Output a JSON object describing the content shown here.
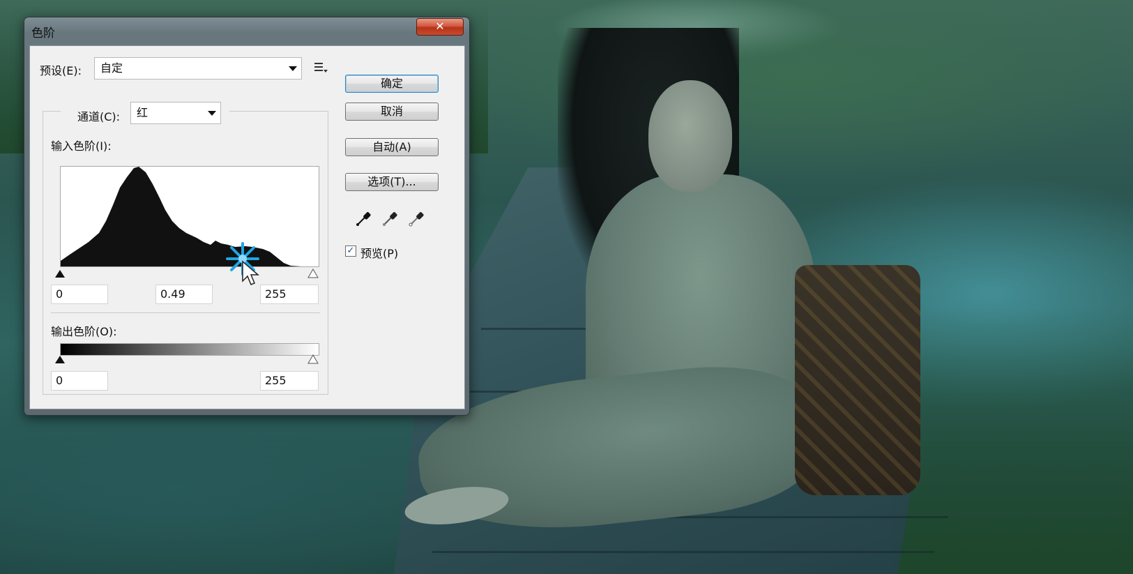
{
  "dialog": {
    "title": "色阶",
    "close_label": "✕"
  },
  "preset": {
    "label": "预设(E):",
    "value": "自定"
  },
  "channel": {
    "label": "通道(C):",
    "value": "红"
  },
  "input_levels": {
    "label": "输入色阶(I):",
    "black": "0",
    "gamma": "0.49",
    "white": "255"
  },
  "output_levels": {
    "label": "输出色阶(O):",
    "black": "0",
    "white": "255"
  },
  "buttons": {
    "ok": "确定",
    "cancel": "取消",
    "auto": "自动(A)",
    "options": "选项(T)..."
  },
  "preview": {
    "label": "预览(P)",
    "checked": true
  },
  "icons": {
    "black_eyedropper": "eyedropper-black-icon",
    "gray_eyedropper": "eyedropper-gray-icon",
    "white_eyedropper": "eyedropper-white-icon",
    "preset_menu": "menu-list-icon",
    "cursor": "arrow-cursor-icon",
    "click": "click-sparkle-icon"
  },
  "colors": {
    "accent_sparkle": "#1ea6e6",
    "close_button": "#c9462a"
  }
}
